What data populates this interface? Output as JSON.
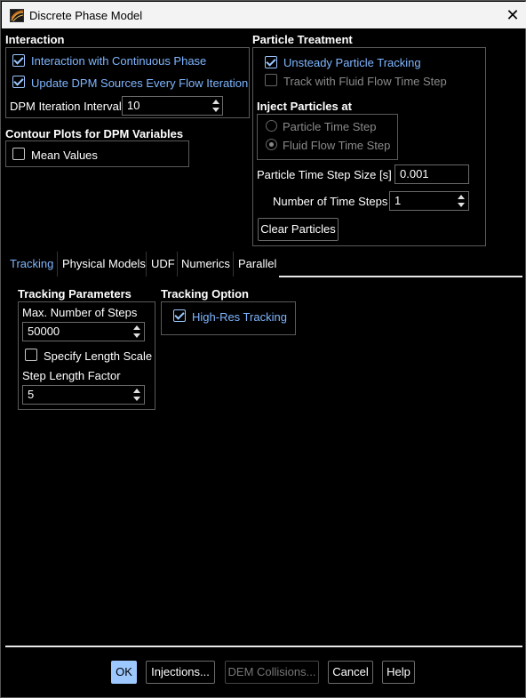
{
  "window": {
    "title": "Discrete Phase Model",
    "close_icon": "close-icon"
  },
  "interaction": {
    "header": "Interaction",
    "continuous_phase": {
      "label": "Interaction with Continuous Phase",
      "checked": true
    },
    "update_sources": {
      "label": "Update DPM Sources Every Flow Iteration",
      "checked": true
    },
    "iteration_interval": {
      "label": "DPM Iteration Interval",
      "value": "10"
    }
  },
  "contour": {
    "header": "Contour Plots for DPM Variables",
    "mean_values": {
      "label": "Mean Values",
      "checked": false
    }
  },
  "particle_treatment": {
    "header": "Particle Treatment",
    "unsteady": {
      "label": "Unsteady Particle Tracking",
      "checked": true
    },
    "track_fluid": {
      "label": "Track with Fluid Flow Time Step",
      "checked": false
    }
  },
  "inject": {
    "header": "Inject Particles at",
    "options": [
      "Particle Time Step",
      "Fluid Flow Time Step"
    ],
    "selected": "Fluid Flow Time Step",
    "step_size": {
      "label": "Particle Time Step Size [s]",
      "value": "0.001"
    },
    "num_steps": {
      "label": "Number of Time Steps",
      "value": "1"
    },
    "clear_button": "Clear Particles"
  },
  "tabs": [
    "Tracking",
    "Physical Models",
    "UDF",
    "Numerics",
    "Parallel"
  ],
  "active_tab": "Tracking",
  "tracking_params": {
    "header": "Tracking Parameters",
    "max_steps": {
      "label": "Max. Number of Steps",
      "value": "50000"
    },
    "specify_length": {
      "label": "Specify Length Scale",
      "checked": false
    },
    "step_length": {
      "label": "Step Length Factor",
      "value": "5"
    }
  },
  "tracking_option": {
    "header": "Tracking Option",
    "high_res": {
      "label": "High-Res Tracking",
      "checked": true
    }
  },
  "footer": {
    "ok": "OK",
    "injections": "Injections...",
    "dem": "DEM Collisions...",
    "cancel": "Cancel",
    "help": "Help"
  },
  "colors": {
    "accent": "#9cc7ff",
    "link_blue": "#7fb6ff",
    "background": "#000000",
    "titlebar": "#f3f3f3"
  }
}
